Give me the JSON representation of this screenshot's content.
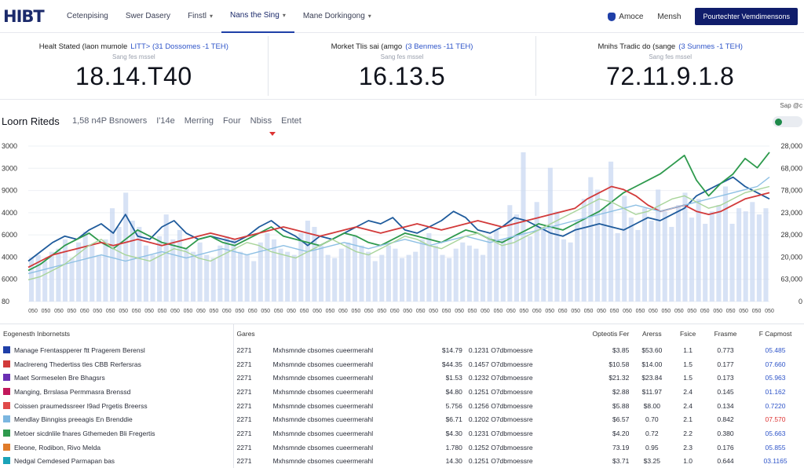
{
  "nav": {
    "logo": "HIBT",
    "items": [
      {
        "label": "Cetenpising",
        "caret": false,
        "active": false
      },
      {
        "label": "Swer Dasery",
        "caret": false,
        "active": false
      },
      {
        "label": "Finstl",
        "caret": true,
        "active": false
      },
      {
        "label": "Nans the Sing",
        "caret": true,
        "active": true
      },
      {
        "label": "Mane Dorkingong",
        "caret": true,
        "active": false
      }
    ],
    "link1": "Amoce",
    "link2": "Mensh",
    "cta": "Pourtechter Vemdimensons"
  },
  "kpis": [
    {
      "title": "Healt Stated",
      "title2": "(laon mumole",
      "highlight": "LITT> (31 Dossomes -1 TEH)",
      "sub": "Sang fes mssel",
      "value": "18.14.T40"
    },
    {
      "title": "Morket Tlis sai",
      "title2": "(amgo",
      "highlight": "(3 Benmes -11 TEH)",
      "sub": "Sang fes mssel",
      "value": "16.13.5"
    },
    {
      "title": "Mnihs Tradic do",
      "title2": "(sange",
      "highlight": "(3 Sunmes -1 TEH)",
      "sub": "Sang fes mssel",
      "value": "72.11.9.1.8"
    }
  ],
  "chart_header": {
    "title": "Loorn Riteds",
    "tabs": [
      "1,58 n4P Bsnowers",
      "I'14e",
      "Merring",
      "Four",
      "Nbiss",
      "Entet"
    ],
    "option_label": "Sap @c"
  },
  "chart_data": {
    "type": "line",
    "y_left_ticks": [
      "3000",
      "3000",
      "9000",
      "4000",
      "6000",
      "4000",
      "6000",
      "80"
    ],
    "y_right_ticks": [
      "28,000",
      "68,000",
      "78,000",
      "23,000",
      "28,000",
      "20,000",
      "63,000",
      "0"
    ],
    "ylim": [
      0,
      100
    ],
    "x_tick_count": 58,
    "x_tick_label": "050",
    "bars": [
      28,
      30,
      26,
      32,
      34,
      40,
      28,
      38,
      45,
      36,
      30,
      40,
      60,
      48,
      70,
      52,
      48,
      36,
      30,
      42,
      56,
      40,
      46,
      34,
      32,
      38,
      30,
      28,
      36,
      42,
      40,
      32,
      30,
      26,
      38,
      44,
      40,
      34,
      32,
      30,
      44,
      52,
      48,
      36,
      30,
      28,
      34,
      38,
      42,
      36,
      32,
      26,
      30,
      36,
      34,
      28,
      30,
      32,
      40,
      44,
      36,
      30,
      28,
      34,
      38,
      36,
      34,
      30,
      42,
      46,
      40,
      62,
      56,
      96,
      42,
      64,
      48,
      86,
      58,
      40,
      38,
      52,
      66,
      80,
      72,
      60,
      90,
      44,
      68,
      54,
      46,
      60,
      52,
      72,
      58,
      48,
      62,
      70,
      54,
      66,
      50,
      58,
      62,
      74,
      50,
      60,
      58,
      64,
      56,
      60
    ],
    "series": [
      {
        "color": "#1f5b9c",
        "values": [
          26,
          32,
          38,
          42,
          40,
          46,
          50,
          44,
          56,
          42,
          40,
          48,
          52,
          44,
          40,
          42,
          40,
          38,
          42,
          48,
          52,
          46,
          42,
          36,
          42,
          40,
          44,
          48,
          52,
          50,
          54,
          46,
          44,
          48,
          52,
          58,
          54,
          46,
          44,
          48,
          54,
          52,
          48,
          44,
          42,
          46,
          48,
          50,
          48,
          46,
          50,
          54,
          52,
          56,
          60,
          68,
          72,
          76,
          80,
          74,
          70,
          66
        ]
      },
      {
        "color": "#2e9a4d",
        "values": [
          20,
          24,
          30,
          36,
          40,
          44,
          38,
          34,
          40,
          46,
          42,
          38,
          36,
          34,
          40,
          42,
          38,
          36,
          40,
          44,
          48,
          42,
          40,
          38,
          36,
          40,
          44,
          42,
          38,
          36,
          40,
          44,
          42,
          40,
          38,
          42,
          46,
          44,
          40,
          38,
          42,
          46,
          50,
          48,
          46,
          50,
          54,
          58,
          64,
          70,
          74,
          78,
          82,
          88,
          94,
          78,
          68,
          76,
          82,
          92,
          86,
          96
        ]
      },
      {
        "color": "#d23a3a",
        "values": [
          22,
          26,
          30,
          32,
          34,
          36,
          38,
          36,
          38,
          40,
          38,
          36,
          38,
          40,
          42,
          44,
          42,
          40,
          42,
          44,
          46,
          48,
          46,
          44,
          42,
          44,
          46,
          48,
          46,
          44,
          46,
          48,
          50,
          48,
          46,
          48,
          50,
          52,
          50,
          48,
          50,
          52,
          54,
          56,
          58,
          60,
          66,
          70,
          74,
          72,
          68,
          62,
          58,
          60,
          62,
          58,
          56,
          58,
          62,
          66,
          68,
          70
        ]
      },
      {
        "color": "#8ec0e4",
        "values": [
          18,
          20,
          22,
          24,
          26,
          28,
          30,
          28,
          26,
          28,
          30,
          32,
          30,
          28,
          30,
          32,
          34,
          32,
          30,
          32,
          34,
          36,
          34,
          32,
          34,
          36,
          38,
          36,
          34,
          36,
          38,
          40,
          38,
          36,
          38,
          40,
          42,
          40,
          38,
          40,
          42,
          44,
          46,
          48,
          50,
          52,
          54,
          56,
          58,
          60,
          62,
          60,
          58,
          60,
          62,
          64,
          66,
          68,
          70,
          72,
          74,
          80
        ]
      },
      {
        "color": "#a8d49a",
        "values": [
          14,
          16,
          20,
          24,
          30,
          36,
          40,
          34,
          30,
          28,
          26,
          30,
          34,
          32,
          28,
          26,
          30,
          34,
          38,
          36,
          32,
          30,
          28,
          32,
          36,
          40,
          36,
          32,
          30,
          34,
          38,
          42,
          40,
          36,
          34,
          38,
          42,
          44,
          40,
          36,
          38,
          42,
          46,
          50,
          54,
          58,
          62,
          66,
          64,
          60,
          56,
          58,
          62,
          66,
          68,
          64,
          60,
          62,
          66,
          70,
          72,
          74
        ]
      }
    ]
  },
  "table": {
    "headers": [
      "Eogenesth Inbornetsts",
      "Gares",
      "",
      "",
      "",
      "Opteotis Fer",
      "Arerss",
      "Fsice",
      "Frasme",
      "F Capmost"
    ],
    "rows": [
      {
        "color": "#1f3fa8",
        "name": "Manage Frentaspperer ftt Pragerem Berensl",
        "date": "2271",
        "desc": "Mxhsmnde cbsomes cueermerahl",
        "v1": "$14.79",
        "v2": "0.1231 O7dbmoessre",
        "v3": "$3.85",
        "v4": "$53.60",
        "v5": "1.1",
        "v6": "0.773",
        "v7": "05.485",
        "neg": false
      },
      {
        "color": "#d23a3a",
        "name": "Maclrereng Thedertiss tles CBB Rerfersras",
        "date": "2271",
        "desc": "Mxhsmnde cbsomes cueermerahl",
        "v1": "$44.35",
        "v2": "0.1457 O7dbmoessre",
        "v3": "$10.58",
        "v4": "$14.00",
        "v5": "1.5",
        "v6": "0.177",
        "v7": "07.660",
        "neg": false
      },
      {
        "color": "#6a2fb3",
        "name": "Maet Sormeselen Bre Bhagsrs",
        "date": "2271",
        "desc": "Mxhsmnde cbsomes cueermerahl",
        "v1": "$1.53",
        "v2": "0.1232 O7dbmoessre",
        "v3": "$21.32",
        "v4": "$23.84",
        "v5": "1.5",
        "v6": "0.173",
        "v7": "05.963",
        "neg": false
      },
      {
        "color": "#c2185b",
        "name": "Manging, Brrslasa Permmasra Brenssd",
        "date": "2271",
        "desc": "Mxhsmnde cbsomes cueermerahl",
        "v1": "$4.80",
        "v2": "0.1251 O7dbmoessre",
        "v3": "$2.88",
        "v4": "$11.97",
        "v5": "2.4",
        "v6": "0.145",
        "v7": "01.162",
        "neg": false
      },
      {
        "color": "#e04a4a",
        "name": "Coissen praumedssreer I9ad Prgetis Breerss",
        "date": "2271",
        "desc": "Mxhsmnde cbsomes cueermerahl",
        "v1": "5.756",
        "v2": "0.1256 O7dbmoessre",
        "v3": "$5.88",
        "v4": "$8.00",
        "v5": "2.4",
        "v6": "0.134",
        "v7": "0.7220",
        "neg": false
      },
      {
        "color": "#7bb6e0",
        "name": "Mendlay Binngiss preeagis En Brenddie",
        "date": "2271",
        "desc": "Mxhsmnde cbsomes cueermerahl",
        "v1": "$6.71",
        "v2": "0.1202 O7dbmoessre",
        "v3": "$6.57",
        "v4": "0.70",
        "v5": "2.1",
        "v6": "0.842",
        "v7": "07.570",
        "neg": true
      },
      {
        "color": "#2e9a4d",
        "name": "Metoer sicdnlile fnares Gthemeden Bli Fregertis",
        "date": "2271",
        "desc": "Mxhsmnde cbsomes cueermerahl",
        "v1": "$4.30",
        "v2": "0.1231 O7dbmoessre",
        "v3": "$4.20",
        "v4": "0.72",
        "v5": "2.2",
        "v6": "0.380",
        "v7": "05.663",
        "neg": false
      },
      {
        "color": "#e07b2a",
        "name": "Eleone, Rodibon, Rivo Melda",
        "date": "2271",
        "desc": "Mxhsmnde cbsomes cueermerahl",
        "v1": "1.780",
        "v2": "0.1252 O7dbmoessre",
        "v3": "73.19",
        "v4": "0.95",
        "v5": "2.3",
        "v6": "0.176",
        "v7": "05.855",
        "neg": false
      },
      {
        "color": "#1aa3b8",
        "name": "Nedgal Cemdesed Parmapan bas",
        "date": "2271",
        "desc": "Mxhsmnde cbsomes cueermerahl",
        "v1": "14.30",
        "v2": "0.1251 O7dbmoessre",
        "v3": "$3.71",
        "v4": "$3.25",
        "v5": "1.0",
        "v6": "0.644",
        "v7": "03.1165",
        "neg": false
      }
    ]
  }
}
